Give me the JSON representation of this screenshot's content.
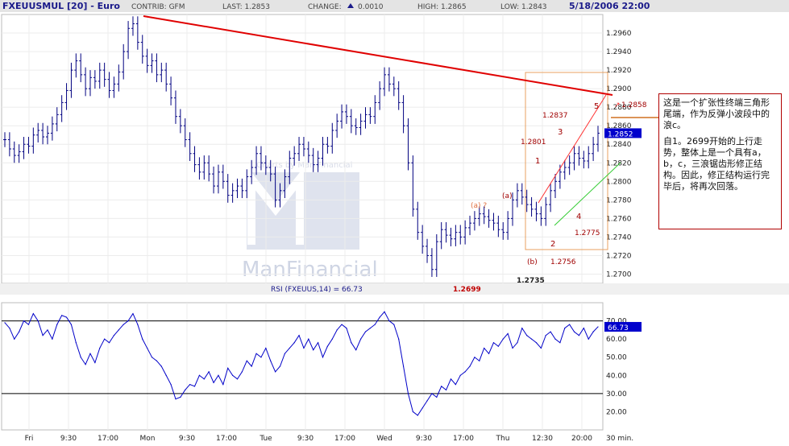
{
  "header": {
    "symbol": "FXEUUSMUL [20] - Euro",
    "contrib": "CONTRIB: GFM",
    "last": "LAST: 1.2853",
    "change_label": "CHANGE:",
    "change_value": "0.0010",
    "high": "HIGH: 1.2865",
    "low": "LOW: 1.2843",
    "datetime": "5/18/2006 22:00"
  },
  "watermark": {
    "line1": "Charts by Man Financial",
    "line2": "ManFinancial"
  },
  "colors": {
    "price": "#000080",
    "rsi": "#0000c8",
    "trend": "#e00000",
    "channel_red": "#ff3333",
    "channel_green": "#33cc33",
    "box": "#e8a060",
    "wave": "#a00000",
    "tag_bg": "#0000cc"
  },
  "rsi_label": "RSI (FXEUUS,14) = 66.73",
  "low_labels": {
    "l1": "1.2699",
    "l2": "1.2735"
  },
  "annotations": {
    "p1": "1.2801",
    "p2": "1.2837",
    "p3": "1.2858",
    "p4": "1.2775",
    "p5": "1.2756",
    "w1": "1",
    "w2": "2",
    "w3": "3",
    "w4": "4",
    "w5": "5",
    "wa": "(a)",
    "wb": "(b)",
    "wa2": "(a) ?"
  },
  "note": {
    "para1": "这是一个扩张性终端三角形尾端，作为反弹小波段中的浪c。",
    "para2": "自1。2699开始的上行走势，整体上是一个具有a，b，c，三浪锯齿形修正结构。因此，修正结构运行完毕后，将再次回落。"
  },
  "x_axis": {
    "labels": [
      "Fri",
      "9:30",
      "17:00",
      "Mon",
      "9:30",
      "17:00",
      "Tue",
      "9:30",
      "17:00",
      "Wed",
      "9:30",
      "17:00",
      "Thu",
      "12:30",
      "20:00"
    ],
    "unit": "30 min."
  },
  "chart_data": [
    {
      "type": "candlestick",
      "title": "FXEUUSMUL [20] - Euro",
      "ylim": [
        1.269,
        1.298
      ],
      "y_ticks": [
        "1.2960",
        "1.2940",
        "1.2920",
        "1.2900",
        "1.2880",
        "1.2860",
        "1.2840",
        "1.2820",
        "1.2800",
        "1.2780",
        "1.2760",
        "1.2740",
        "1.2720",
        "1.2700"
      ],
      "last_value": "1.2852",
      "series": [
        {
          "name": "FXEUUSMUL",
          "values": [
            1.2845,
            1.2835,
            1.2828,
            1.2832,
            1.284,
            1.2838,
            1.285,
            1.2855,
            1.2848,
            1.2852,
            1.2862,
            1.2872,
            1.2885,
            1.2898,
            1.292,
            1.293,
            1.2915,
            1.29,
            1.2912,
            1.2908,
            1.292,
            1.291,
            1.2898,
            1.2905,
            1.2918,
            1.294,
            1.2965,
            1.297,
            1.295,
            1.2935,
            1.2925,
            1.293,
            1.2915,
            1.292,
            1.2905,
            1.289,
            1.287,
            1.286,
            1.2845,
            1.283,
            1.2818,
            1.281,
            1.282,
            1.2808,
            1.2795,
            1.281,
            1.28,
            1.2785,
            1.279,
            1.2795,
            1.279,
            1.2805,
            1.2815,
            1.283,
            1.282,
            1.2815,
            1.2808,
            1.278,
            1.279,
            1.2805,
            1.2825,
            1.283,
            1.284,
            1.2835,
            1.2828,
            1.2818,
            1.2825,
            1.284,
            1.2838,
            1.2855,
            1.2865,
            1.2875,
            1.287,
            1.286,
            1.2858,
            1.2865,
            1.2872,
            1.287,
            1.2885,
            1.29,
            1.2915,
            1.2905,
            1.29,
            1.2885,
            1.286,
            1.282,
            1.277,
            1.2745,
            1.273,
            1.272,
            1.2705,
            1.2735,
            1.2748,
            1.2742,
            1.2738,
            1.2745,
            1.274,
            1.275,
            1.2755,
            1.276,
            1.2765,
            1.2762,
            1.2758,
            1.2755,
            1.2748,
            1.2745,
            1.276,
            1.278,
            1.279,
            1.2783,
            1.2775,
            1.277,
            1.2765,
            1.276,
            1.2775,
            1.279,
            1.28,
            1.281,
            1.2815,
            1.282,
            1.283,
            1.2825,
            1.2822,
            1.283,
            1.284,
            1.2852
          ]
        }
      ]
    },
    {
      "type": "line",
      "title": "RSI (FXEUUS,14) = 66.73",
      "ylim": [
        10,
        80
      ],
      "y_ticks": [
        "70.00",
        "60.00",
        "50.00",
        "40.00",
        "30.00",
        "20.00"
      ],
      "ref_lines": [
        70,
        30
      ],
      "last_value": "66.73",
      "series": [
        {
          "name": "RSI (FXEUUS,14)",
          "values": [
            69,
            66,
            60,
            64,
            70,
            68,
            74,
            70,
            62,
            65,
            60,
            68,
            73,
            72,
            68,
            58,
            50,
            46,
            52,
            47,
            55,
            60,
            58,
            62,
            65,
            68,
            70,
            74,
            68,
            60,
            55,
            50,
            48,
            45,
            40,
            35,
            27,
            28,
            32,
            35,
            34,
            40,
            38,
            42,
            36,
            40,
            35,
            44,
            40,
            38,
            42,
            48,
            45,
            52,
            50,
            55,
            48,
            42,
            45,
            52,
            55,
            58,
            62,
            55,
            60,
            54,
            58,
            50,
            56,
            60,
            65,
            68,
            66,
            58,
            54,
            60,
            64,
            66,
            68,
            72,
            75,
            70,
            68,
            60,
            45,
            30,
            20,
            18,
            22,
            26,
            30,
            28,
            34,
            32,
            38,
            35,
            40,
            42,
            45,
            50,
            48,
            55,
            52,
            58,
            56,
            60,
            63,
            55,
            58,
            66,
            62,
            60,
            58,
            55,
            62,
            64,
            60,
            58,
            66,
            68,
            64,
            62,
            66,
            60,
            64,
            66.73
          ]
        }
      ]
    }
  ]
}
